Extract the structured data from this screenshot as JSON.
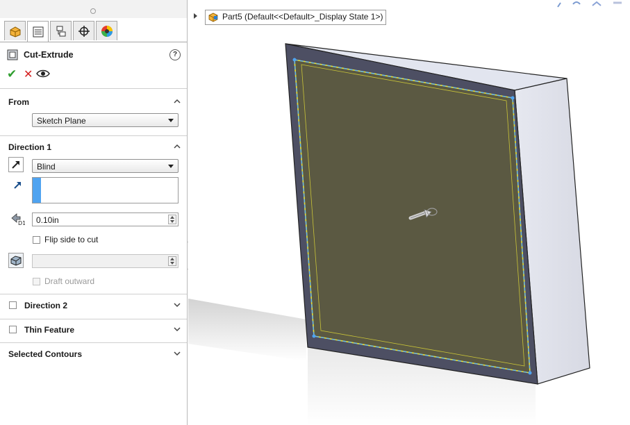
{
  "manager_tabs": [
    "feature-manager",
    "property-manager",
    "configuration-manager",
    "dimxpert-manager",
    "display-manager"
  ],
  "property_manager": {
    "title": "Cut-Extrude",
    "help_symbol": "?"
  },
  "from_section": {
    "header": "From",
    "start_condition": "Sketch Plane"
  },
  "direction1": {
    "header": "Direction 1",
    "end_condition": "Blind",
    "depth": "0.10in",
    "flip_side_label": "Flip side to cut",
    "draft_outward_label": "Draft outward"
  },
  "direction2": {
    "header": "Direction 2"
  },
  "thin_feature": {
    "header": "Thin Feature"
  },
  "selected_contours": {
    "header": "Selected Contours"
  },
  "breadcrumb": {
    "text": "Part5  (Default<<Default>_Display State 1>)"
  },
  "colors": {
    "accent_blue": "#4fa3f0",
    "ok_green": "#2f9e2f",
    "cancel_red": "#d42020",
    "sketch_yellow": "#e8e23a",
    "face_olive": "#5b5942"
  }
}
